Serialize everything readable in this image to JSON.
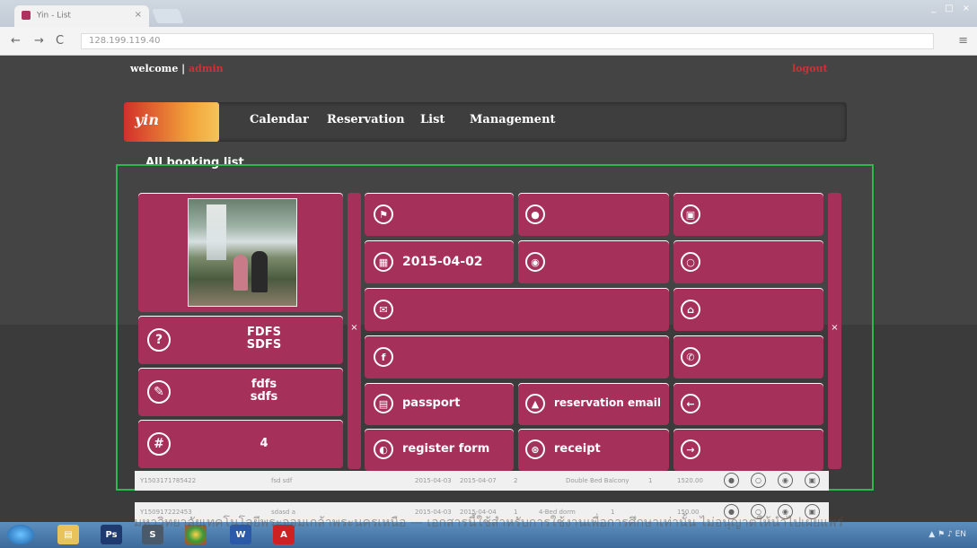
{
  "browser": {
    "tab_title": "Yin - List",
    "tab_close": "×",
    "url": "128.199.119.40",
    "back": "←",
    "forward": "→",
    "reload": "C",
    "menu": "≡",
    "window_controls": [
      "_",
      "□",
      "×"
    ]
  },
  "header": {
    "welcome": "welcome",
    "separator": "|",
    "username": "admin",
    "logout": "logout"
  },
  "nav": {
    "logo": "yin",
    "items": [
      "Calendar",
      "Reservation",
      "List",
      "Management"
    ]
  },
  "section_title": "All booking list",
  "detail": {
    "name": "FDFS\nSDFS",
    "note": "fdfs\nsdfs",
    "count": "4",
    "checkin_date": "2015-04-02",
    "passport": "passport",
    "reservation_email": "reservation email",
    "register_form": "register form",
    "receipt": "receipt",
    "close": "×"
  },
  "icons": {
    "help": "?",
    "note": "✎",
    "hash": "#",
    "flag": "⚑",
    "person": "●",
    "door": "▣",
    "calendar": "▦",
    "bed": "◉",
    "bulb": "○",
    "mail": "✉",
    "home": "⌂",
    "facebook": "f",
    "phone": "✆",
    "passport": "▤",
    "email_doc": "▲",
    "arrow_left": "←",
    "register": "◐",
    "receipt": "⊛",
    "arrow_right": "→"
  },
  "rows": [
    {
      "id": "Y1503171785422",
      "name": "fsd sdf",
      "checkin": "2015-04-03",
      "checkout": "2015-04-07",
      "guests": "2",
      "room": "Double Bed Balcony",
      "qty": "1",
      "price": "1520.00"
    },
    {
      "id": "Y150917222453",
      "name": "sdasd a",
      "checkin": "2015-04-03",
      "checkout": "2015-04-04",
      "guests": "1",
      "room": "4-Bed dorm",
      "qty": "1",
      "price": "150.00"
    }
  ],
  "watermark": "มหาวิทยาลัยเทคโนโลยีพระจอมเกล้าพระนครเหนือ — เอกสารนี้ใช้สำหรับการใช้งานเพื่อการศึกษาเท่านั้น ไม่อนุญาตให้นำไปเผยแพร่",
  "taskbar": {
    "apps": [
      "Ps",
      "S",
      "W",
      "A"
    ],
    "tray": "▲ ⚑ ♪ EN"
  }
}
